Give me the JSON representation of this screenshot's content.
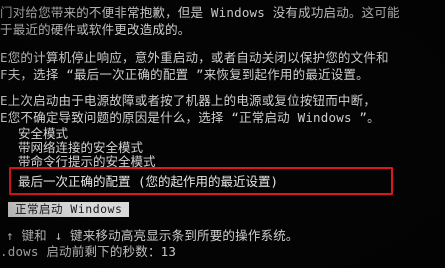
{
  "intro": [
    "门对给您带来的不便非常抱歉，但是 Windows 没有成功启动。这可能",
    "于最近的硬件或软件更改造成的。"
  ],
  "para_shutdown": [
    "E您的计算机停止响应，意外重启动，或者自动关闭以保护您的文件和",
    "F夫，选择 “最后一次正确的配置 ”来恢复到起作用的最近设置。"
  ],
  "para_power": [
    "E上次启动由于电源故障或者按了机器上的电源或复位按钮而中断，",
    "E您不确定导致问题的原因是什么，选择 “正常启动 Windows ”。"
  ],
  "menu": {
    "safe_mode": "安全模式",
    "safe_mode_network": "带网络连接的安全模式",
    "safe_mode_cmd": "带命令行提示的安全模式",
    "last_known_good": "最后一次正确的配置 (您的起作用的最近设置)",
    "start_normally": "正常启动 Windows"
  },
  "footer": {
    "keys_hint": "↑ 键和 ↓ 键来移动高亮显示条到所要的操作系统。",
    "countdown_label": ".dows 启动前剩下的秒数：",
    "countdown_value": "13"
  },
  "colors": {
    "background": "#040404",
    "text": "#cfcfcf",
    "highlight_box": "#e0161c",
    "selected_bar": "#d9d9d9"
  }
}
